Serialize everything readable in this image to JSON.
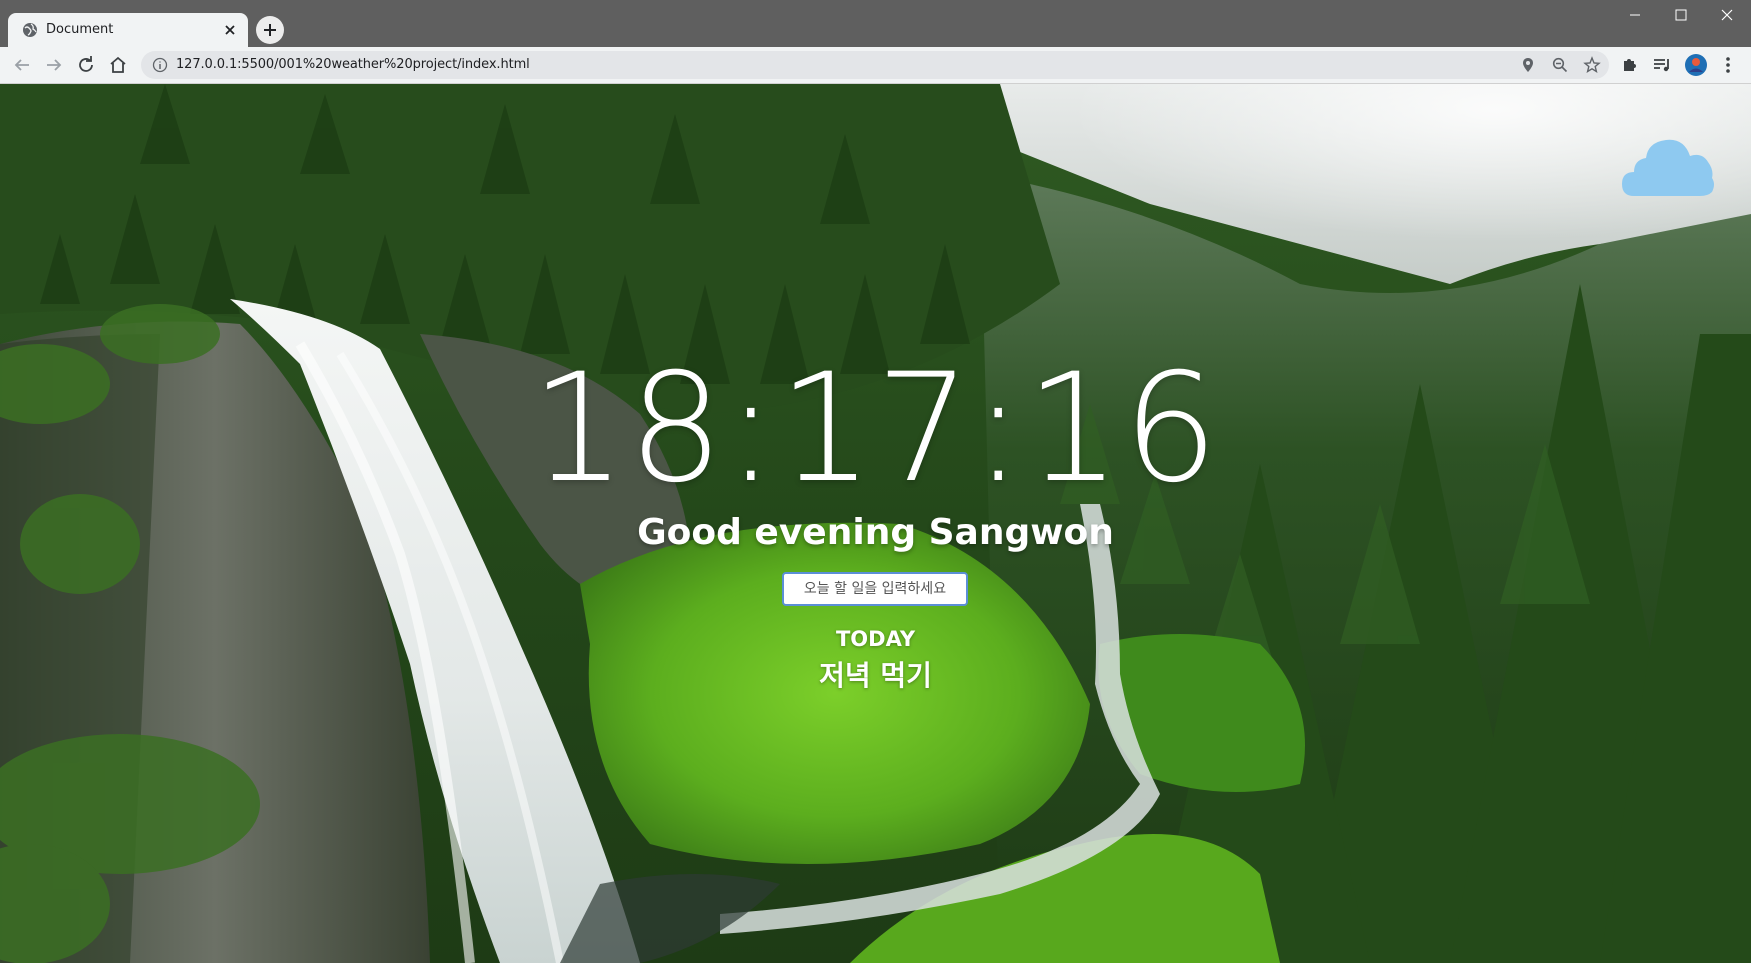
{
  "browser": {
    "tab_title": "Document",
    "url": "127.0.0.1:5500/001%20weather%20project/index.html",
    "icons": {
      "favicon": "globe-icon",
      "tab_close": "close-icon",
      "new_tab": "plus-icon",
      "back": "arrow-left-icon",
      "forward": "arrow-right-icon",
      "reload": "reload-icon",
      "home": "home-icon",
      "site_info": "info-icon",
      "location": "location-pin-icon",
      "zoom": "zoom-out-icon",
      "bookmark": "star-icon",
      "extensions": "puzzle-icon",
      "media": "playlist-icon",
      "profile": "avatar",
      "menu": "kebab-menu-icon"
    }
  },
  "page": {
    "clock": "18:17:16",
    "greeting": "Good evening Sangwon",
    "todo_placeholder": "오늘 할 일을 입력하세요",
    "todo_title": "TODAY",
    "todos": [
      "저녁 먹기"
    ],
    "weather_icon": "cloud-icon",
    "colors": {
      "cloud": "#8ec9f0",
      "input_border": "#5b8fd6",
      "text": "#ffffff"
    }
  }
}
